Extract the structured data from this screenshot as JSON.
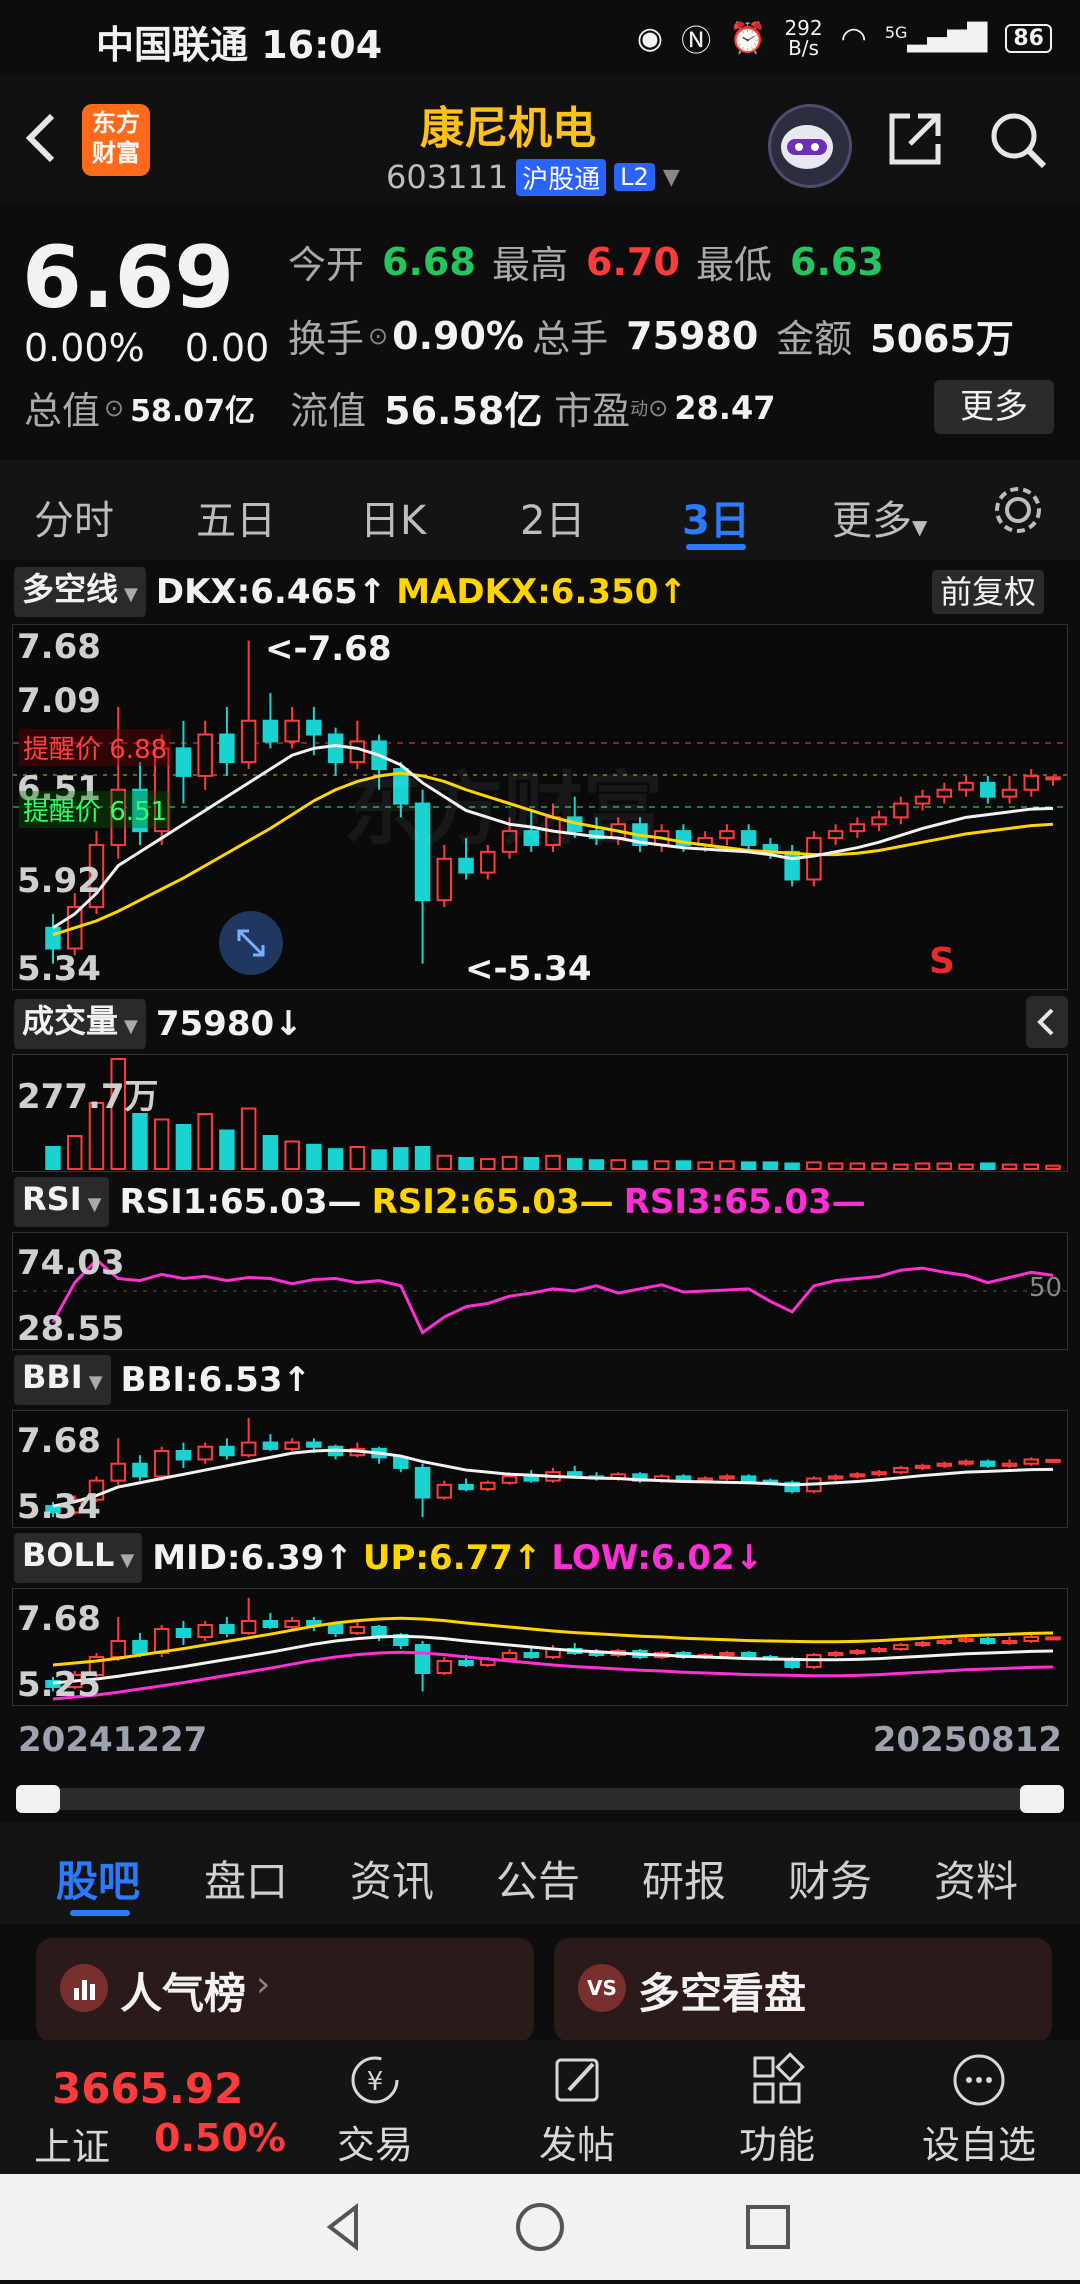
{
  "status_bar": {
    "carrier_time": "中国联通 16:04",
    "net_speed_top": "292",
    "net_speed_bottom": "B/s",
    "signal_label": "5G",
    "battery": "86"
  },
  "header": {
    "back_icon": "chevron-left-icon",
    "brand_logo_line1": "东方",
    "brand_logo_line2": "财富",
    "title": "康尼机电",
    "code": "603111",
    "market_tag": "沪股通",
    "level_tag": "L2",
    "share_icon": "share-icon",
    "search_icon": "search-icon"
  },
  "quote": {
    "price": "6.69",
    "change_pct": "0.00%",
    "change": "0.00",
    "rows": [
      [
        {
          "label": "今开",
          "value": "6.68",
          "color": "green"
        },
        {
          "label": "最高",
          "value": "6.70",
          "color": "red"
        },
        {
          "label": "最低",
          "value": "6.63",
          "color": "green"
        }
      ],
      [
        {
          "label": "换手",
          "value": "0.90%",
          "color": "white"
        },
        {
          "label": "总手",
          "value": "75980",
          "color": "white"
        },
        {
          "label": "金额",
          "value": "5065万",
          "color": "white"
        }
      ],
      [
        {
          "label": "总值",
          "value": "58.07亿",
          "color": "white"
        },
        {
          "label": "流值",
          "value": "56.58亿",
          "color": "white"
        },
        {
          "label": "市盈",
          "value": "28.47",
          "color": "white"
        }
      ]
    ],
    "pe_superscript": "动",
    "more_button": "更多"
  },
  "tabs": [
    "分时",
    "五日",
    "日K",
    "2日",
    "3日",
    "更多"
  ],
  "tabs_active": "3日",
  "tabs_settings_icon": "gear-icon",
  "main_chart": {
    "indicator_btn": "多空线",
    "dkx": "DKX:6.465↑",
    "madkx": "MADKX:6.350↑",
    "adjust_btn": "前复权",
    "y_ticks": [
      "7.68",
      "7.09",
      "6.51",
      "5.92",
      "5.34"
    ],
    "alert_high": "提醒价 6.88",
    "alert_low": "提醒价 6.51",
    "high_marker": "<-7.68",
    "low_marker": "<-5.34",
    "signal": "S",
    "watermark": "东方财富"
  },
  "volume": {
    "indicator_btn": "成交量",
    "value": "75980↓",
    "top_tick": "277.7万",
    "collapse_icon": "chevron-left-icon"
  },
  "rsi": {
    "indicator_btn": "RSI",
    "rsi1": "RSI1:65.03—",
    "rsi2": "RSI2:65.03—",
    "rsi3": "RSI3:65.03—",
    "ticks": [
      "74.03",
      "28.55"
    ],
    "mid_label": "50"
  },
  "bbi": {
    "indicator_btn": "BBI",
    "value": "BBI:6.53↑",
    "ticks": [
      "7.68",
      "5.34"
    ]
  },
  "boll": {
    "indicator_btn": "BOLL",
    "mid": "MID:6.39↑",
    "up": "UP:6.77↑",
    "low": "LOW:6.02↓",
    "ticks": [
      "7.68",
      "5.25"
    ]
  },
  "dates": {
    "start": "20241227",
    "end": "20250812"
  },
  "bottom_tabs": [
    "股吧",
    "盘口",
    "资讯",
    "公告",
    "研报",
    "财务",
    "资料"
  ],
  "bottom_tabs_active": "股吧",
  "cards": [
    {
      "label": "人气榜",
      "icon": "chart-icon"
    },
    {
      "label": "多空看盘",
      "icon": "vs-icon"
    }
  ],
  "nav": {
    "index_value": "3665.92",
    "index_name": "上证",
    "index_change": "0.50%",
    "items": [
      {
        "label": "交易",
        "icon": "yen-icon"
      },
      {
        "label": "发帖",
        "icon": "edit-icon"
      },
      {
        "label": "功能",
        "icon": "grid-icon"
      },
      {
        "label": "设自选",
        "icon": "more-icon"
      }
    ]
  },
  "chart_data": {
    "type": "candlestick",
    "y_range": [
      5.34,
      7.68
    ],
    "candles": [
      {
        "o": 5.6,
        "c": 5.45,
        "h": 5.7,
        "l": 5.34
      },
      {
        "o": 5.45,
        "c": 5.75,
        "h": 5.85,
        "l": 5.4
      },
      {
        "o": 5.75,
        "c": 6.2,
        "h": 6.3,
        "l": 5.7
      },
      {
        "o": 6.2,
        "c": 6.6,
        "h": 7.2,
        "l": 6.1
      },
      {
        "o": 6.6,
        "c": 6.3,
        "h": 6.8,
        "l": 6.2
      },
      {
        "o": 6.3,
        "c": 6.9,
        "h": 7.0,
        "l": 6.2
      },
      {
        "o": 6.9,
        "c": 6.7,
        "h": 7.1,
        "l": 6.5
      },
      {
        "o": 6.7,
        "c": 7.0,
        "h": 7.1,
        "l": 6.6
      },
      {
        "o": 7.0,
        "c": 6.8,
        "h": 7.2,
        "l": 6.7
      },
      {
        "o": 6.8,
        "c": 7.1,
        "h": 7.68,
        "l": 6.75
      },
      {
        "o": 7.1,
        "c": 6.95,
        "h": 7.3,
        "l": 6.9
      },
      {
        "o": 6.95,
        "c": 7.1,
        "h": 7.2,
        "l": 6.9
      },
      {
        "o": 7.1,
        "c": 7.0,
        "h": 7.2,
        "l": 6.85
      },
      {
        "o": 7.0,
        "c": 6.8,
        "h": 7.05,
        "l": 6.7
      },
      {
        "o": 6.8,
        "c": 6.95,
        "h": 7.1,
        "l": 6.75
      },
      {
        "o": 6.95,
        "c": 6.75,
        "h": 7.0,
        "l": 6.6
      },
      {
        "o": 6.75,
        "c": 6.5,
        "h": 6.8,
        "l": 6.4
      },
      {
        "o": 6.5,
        "c": 5.8,
        "h": 6.6,
        "l": 5.34
      },
      {
        "o": 5.8,
        "c": 6.1,
        "h": 6.2,
        "l": 5.75
      },
      {
        "o": 6.1,
        "c": 6.0,
        "h": 6.25,
        "l": 5.95
      },
      {
        "o": 6.0,
        "c": 6.15,
        "h": 6.2,
        "l": 5.95
      },
      {
        "o": 6.15,
        "c": 6.3,
        "h": 6.4,
        "l": 6.1
      },
      {
        "o": 6.3,
        "c": 6.2,
        "h": 6.45,
        "l": 6.15
      },
      {
        "o": 6.2,
        "c": 6.4,
        "h": 6.5,
        "l": 6.15
      },
      {
        "o": 6.4,
        "c": 6.3,
        "h": 6.55,
        "l": 6.25
      },
      {
        "o": 6.3,
        "c": 6.25,
        "h": 6.4,
        "l": 6.2
      },
      {
        "o": 6.25,
        "c": 6.35,
        "h": 6.4,
        "l": 6.2
      },
      {
        "o": 6.35,
        "c": 6.2,
        "h": 6.4,
        "l": 6.15
      },
      {
        "o": 6.2,
        "c": 6.3,
        "h": 6.35,
        "l": 6.15
      },
      {
        "o": 6.3,
        "c": 6.2,
        "h": 6.35,
        "l": 6.15
      },
      {
        "o": 6.2,
        "c": 6.25,
        "h": 6.3,
        "l": 6.15
      },
      {
        "o": 6.25,
        "c": 6.3,
        "h": 6.35,
        "l": 6.2
      },
      {
        "o": 6.3,
        "c": 6.2,
        "h": 6.35,
        "l": 6.15
      },
      {
        "o": 6.2,
        "c": 6.15,
        "h": 6.25,
        "l": 6.1
      },
      {
        "o": 6.15,
        "c": 5.95,
        "h": 6.2,
        "l": 5.9
      },
      {
        "o": 5.95,
        "c": 6.25,
        "h": 6.3,
        "l": 5.9
      },
      {
        "o": 6.25,
        "c": 6.3,
        "h": 6.35,
        "l": 6.2
      },
      {
        "o": 6.3,
        "c": 6.35,
        "h": 6.4,
        "l": 6.25
      },
      {
        "o": 6.35,
        "c": 6.4,
        "h": 6.45,
        "l": 6.3
      },
      {
        "o": 6.4,
        "c": 6.5,
        "h": 6.55,
        "l": 6.35
      },
      {
        "o": 6.5,
        "c": 6.55,
        "h": 6.6,
        "l": 6.45
      },
      {
        "o": 6.55,
        "c": 6.6,
        "h": 6.65,
        "l": 6.5
      },
      {
        "o": 6.6,
        "c": 6.65,
        "h": 6.7,
        "l": 6.55
      },
      {
        "o": 6.65,
        "c": 6.55,
        "h": 6.7,
        "l": 6.5
      },
      {
        "o": 6.55,
        "c": 6.6,
        "h": 6.7,
        "l": 6.5
      },
      {
        "o": 6.6,
        "c": 6.7,
        "h": 6.75,
        "l": 6.55
      },
      {
        "o": 6.68,
        "c": 6.69,
        "h": 6.7,
        "l": 6.63
      }
    ],
    "volumes": [
      0.2,
      0.3,
      0.6,
      1.0,
      0.5,
      0.45,
      0.4,
      0.5,
      0.35,
      0.55,
      0.3,
      0.25,
      0.22,
      0.18,
      0.2,
      0.17,
      0.19,
      0.2,
      0.12,
      0.1,
      0.09,
      0.11,
      0.1,
      0.12,
      0.09,
      0.08,
      0.08,
      0.07,
      0.07,
      0.07,
      0.06,
      0.07,
      0.06,
      0.06,
      0.05,
      0.06,
      0.05,
      0.05,
      0.05,
      0.04,
      0.05,
      0.05,
      0.04,
      0.05,
      0.04,
      0.04,
      0.03
    ],
    "rsi": [
      20,
      58,
      80,
      62,
      60,
      66,
      62,
      64,
      60,
      63,
      62,
      57,
      61,
      62,
      58,
      60,
      55,
      10,
      25,
      35,
      38,
      45,
      48,
      52,
      50,
      55,
      48,
      52,
      56,
      49,
      50,
      51,
      52,
      40,
      30,
      55,
      60,
      62,
      64,
      70,
      72,
      68,
      65,
      58,
      63,
      68,
      65
    ],
    "dkx": [
      5.6,
      5.7,
      5.85,
      6.05,
      6.15,
      6.25,
      6.35,
      6.45,
      6.55,
      6.65,
      6.75,
      6.85,
      6.9,
      6.92,
      6.9,
      6.85,
      6.78,
      6.65,
      6.55,
      6.45,
      6.4,
      6.35,
      6.33,
      6.3,
      6.28,
      6.26,
      6.25,
      6.22,
      6.2,
      6.18,
      6.17,
      6.16,
      6.15,
      6.13,
      6.1,
      6.12,
      6.15,
      6.18,
      6.22,
      6.27,
      6.32,
      6.36,
      6.4,
      6.42,
      6.44,
      6.46,
      6.465
    ],
    "madkx": [
      5.55,
      5.6,
      5.65,
      5.72,
      5.8,
      5.88,
      5.96,
      6.05,
      6.14,
      6.23,
      6.32,
      6.42,
      6.52,
      6.6,
      6.66,
      6.7,
      6.72,
      6.7,
      6.66,
      6.6,
      6.55,
      6.5,
      6.45,
      6.4,
      6.36,
      6.33,
      6.3,
      6.27,
      6.25,
      6.22,
      6.2,
      6.18,
      6.16,
      6.15,
      6.14,
      6.13,
      6.13,
      6.14,
      6.16,
      6.19,
      6.22,
      6.25,
      6.28,
      6.3,
      6.32,
      6.34,
      6.35
    ]
  }
}
